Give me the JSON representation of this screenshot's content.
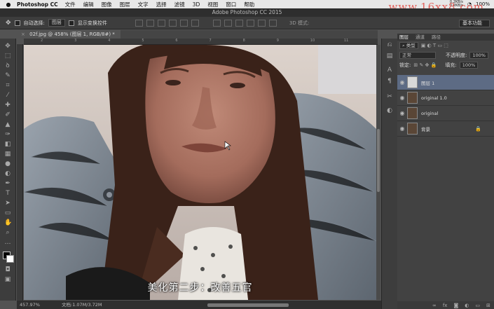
{
  "menubar": {
    "app": "Photoshop CC",
    "items": [
      "文件",
      "编辑",
      "图像",
      "图层",
      "文字",
      "选择",
      "滤镜",
      "3D",
      "视图",
      "窗口",
      "帮助"
    ],
    "net_up": "0.2KB/s",
    "net_down": "0.2KB/s",
    "battery": "100%"
  },
  "watermark": "www.16xx8.com",
  "window_title": "Adobe Photoshop CC 2015",
  "options": {
    "auto_select_label": "自动选择:",
    "auto_select_value": "图层",
    "show_transform_label": "显示变换控件",
    "mode_3d": "3D 模式:",
    "workspace": "基本功能"
  },
  "document_tab": "02f.jpg @ 458% (图层 1, RGB/8#) *",
  "ruler_ticks": [
    "2",
    "3",
    "4",
    "5",
    "6",
    "7",
    "8",
    "9",
    "10",
    "11"
  ],
  "status": {
    "zoom": "457.97%",
    "doc": "文档:1.07M/3.72M"
  },
  "subtitle": "美化第二步：改善五官",
  "layers_panel": {
    "tabs": [
      "图层",
      "通道",
      "路径"
    ],
    "kind": "类型",
    "blend": "正常",
    "opacity_label": "不透明度:",
    "opacity": "100%",
    "lock_label": "锁定:",
    "fill_label": "填充:",
    "fill": "100%",
    "layers": [
      {
        "name": "图层 1",
        "selected": true
      },
      {
        "name": "original 1.0",
        "selected": false
      },
      {
        "name": "original",
        "selected": false
      },
      {
        "name": "背景",
        "selected": false
      }
    ]
  }
}
